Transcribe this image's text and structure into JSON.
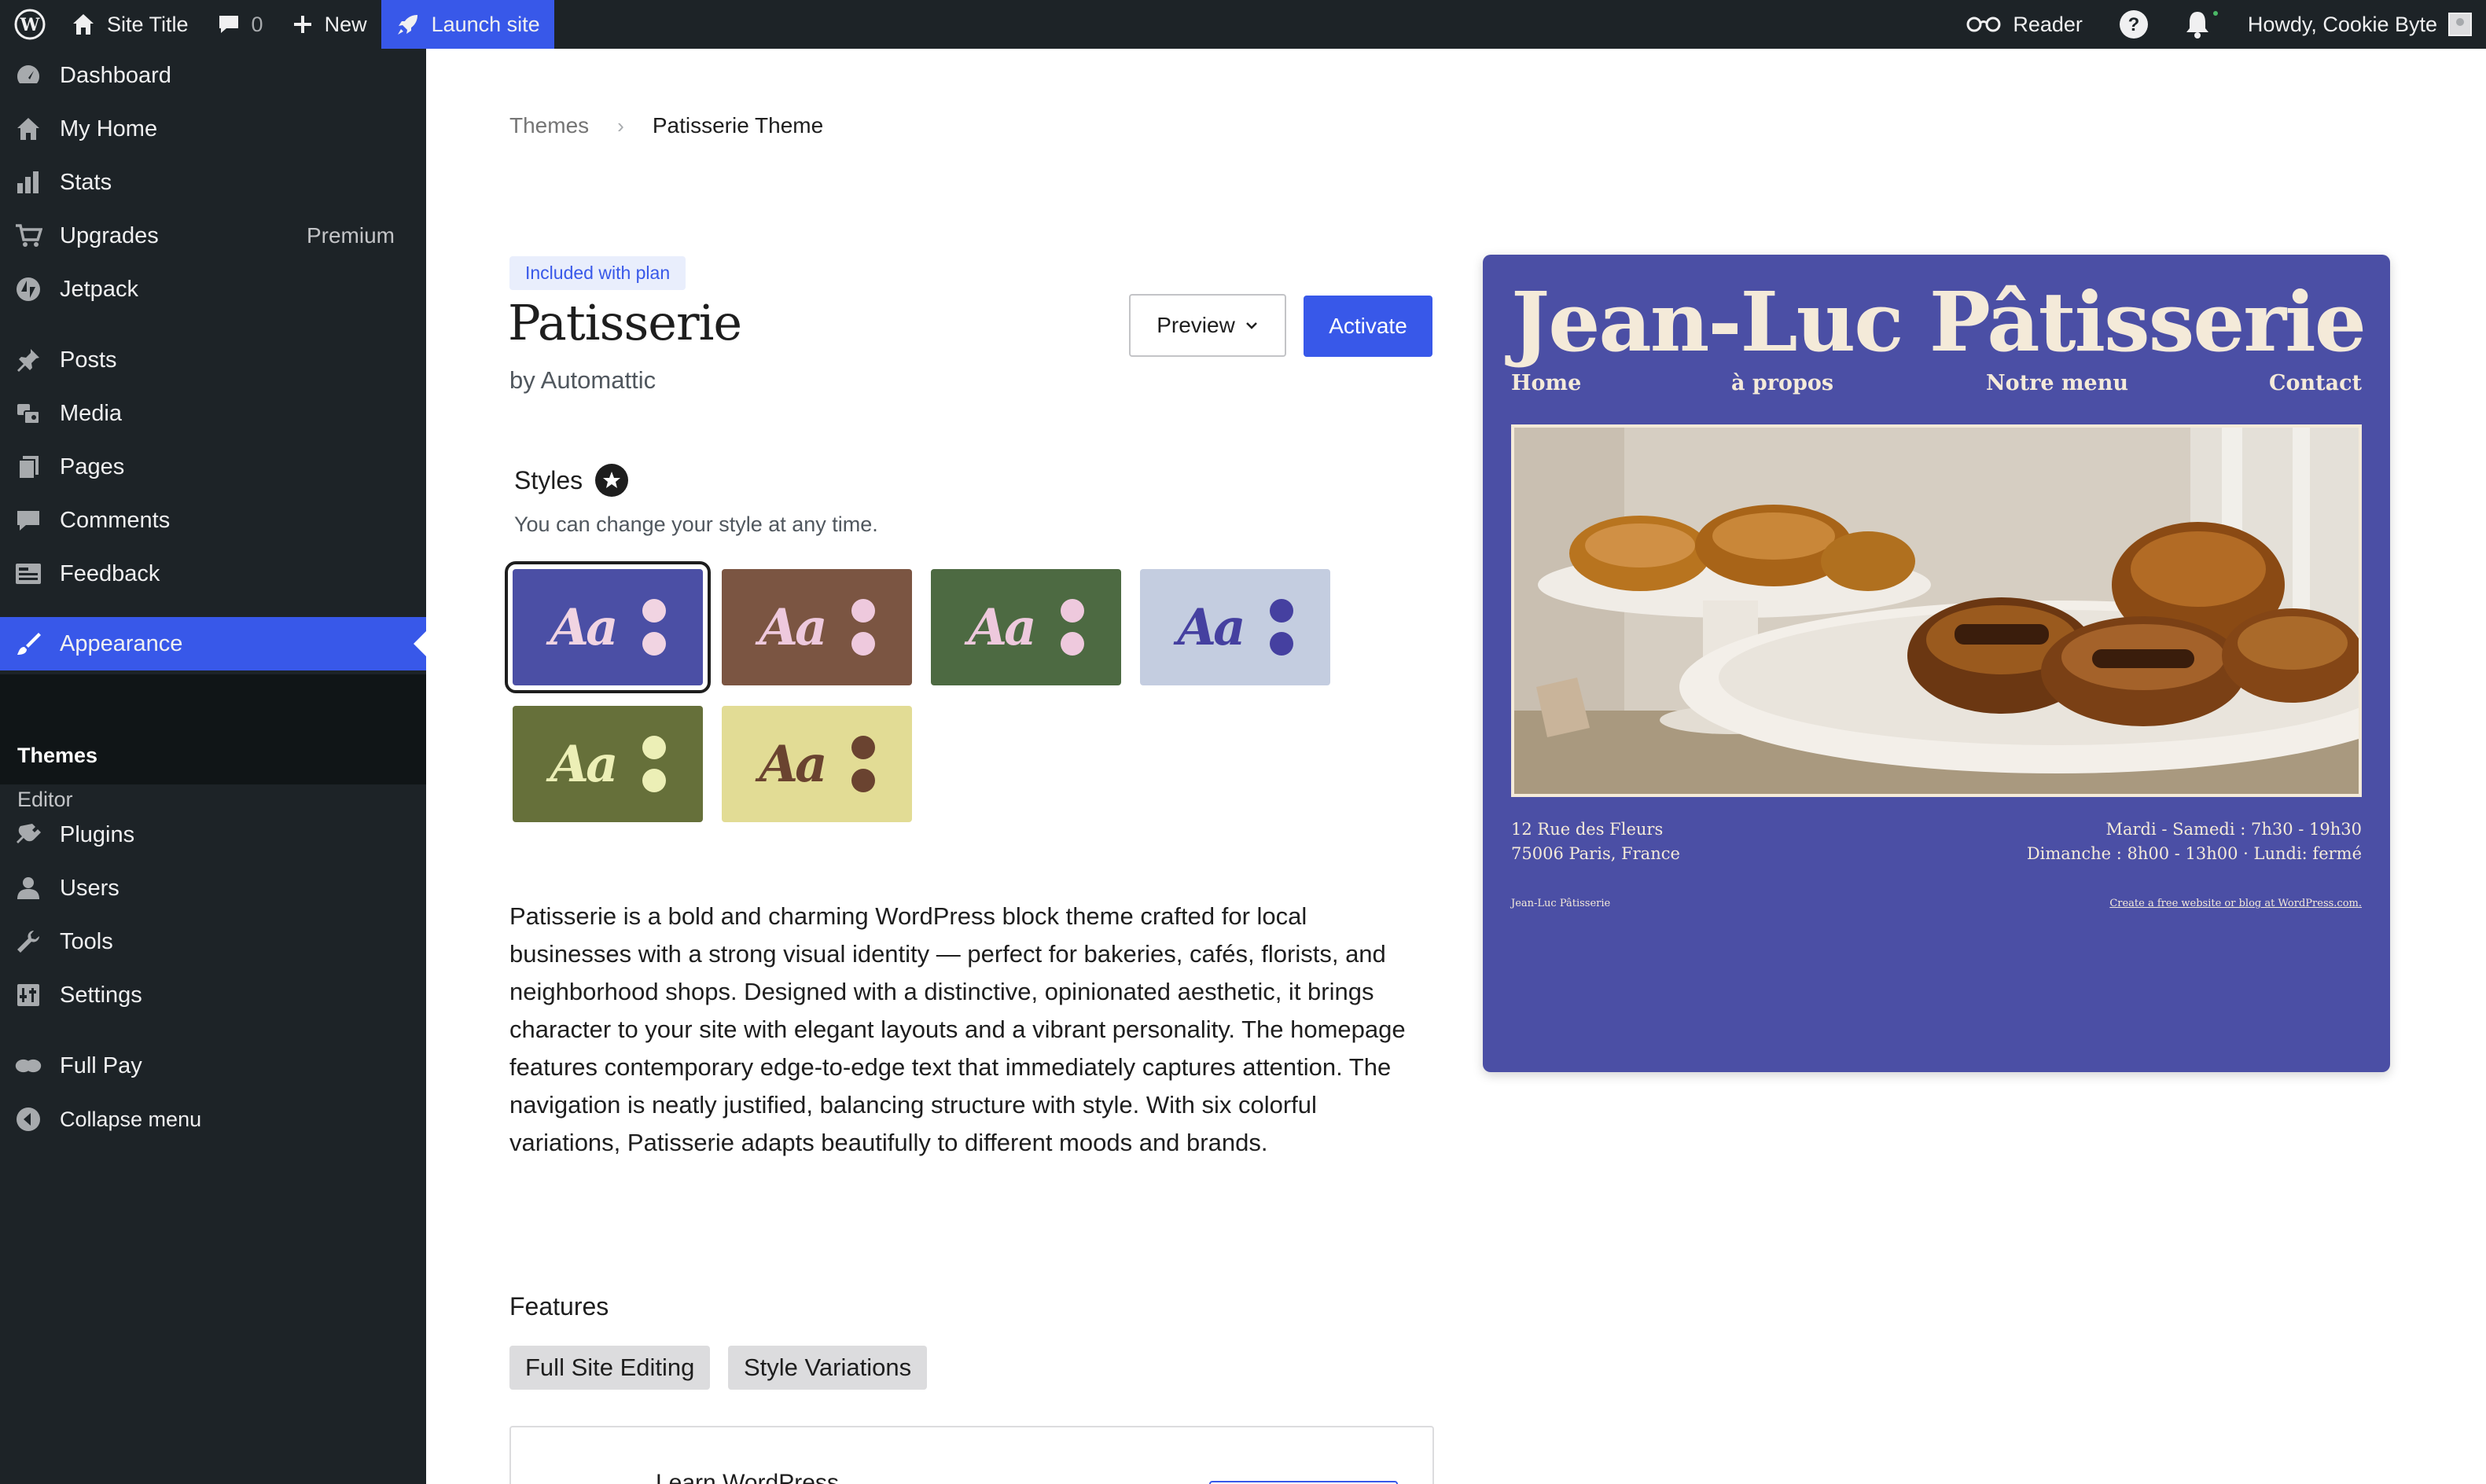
{
  "adminbar": {
    "site_title": "Site Title",
    "comment_count": "0",
    "new_label": "New",
    "launch_label": "Launch site",
    "reader_label": "Reader",
    "howdy_label": "Howdy, Cookie Byte"
  },
  "sidebar": {
    "items": [
      {
        "label": "Dashboard",
        "icon": "dashboard-icon"
      },
      {
        "label": "My Home",
        "icon": "home-icon"
      },
      {
        "label": "Stats",
        "icon": "stats-icon"
      },
      {
        "label": "Upgrades",
        "icon": "cart-icon",
        "badge": "Premium"
      },
      {
        "label": "Jetpack",
        "icon": "jetpack-icon"
      },
      {
        "label": "Posts",
        "icon": "pin-icon"
      },
      {
        "label": "Media",
        "icon": "media-icon"
      },
      {
        "label": "Pages",
        "icon": "pages-icon"
      },
      {
        "label": "Comments",
        "icon": "comment-icon"
      },
      {
        "label": "Feedback",
        "icon": "feedback-icon"
      },
      {
        "label": "Appearance",
        "icon": "brush-icon"
      },
      {
        "label": "Plugins",
        "icon": "plug-icon"
      },
      {
        "label": "Users",
        "icon": "user-icon"
      },
      {
        "label": "Tools",
        "icon": "wrench-icon"
      },
      {
        "label": "Settings",
        "icon": "settings-icon"
      },
      {
        "label": "Full Pay",
        "icon": "fullpay-icon"
      },
      {
        "label": "Collapse menu",
        "icon": "collapse-icon"
      }
    ],
    "submenu": [
      "Themes",
      "Editor"
    ]
  },
  "breadcrumb": {
    "parent": "Themes",
    "current": "Patisserie Theme"
  },
  "theme": {
    "badge": "Included with plan",
    "name": "Patisserie",
    "author": "by Automattic",
    "preview_label": "Preview",
    "activate_label": "Activate"
  },
  "styles": {
    "heading": "Styles",
    "subtext": "You can change your style at any time.",
    "sample": "Aa",
    "variations": [
      {
        "bg": "#4b4fa5",
        "fg": "#f1d4e2",
        "dot1": "#f1d4e2",
        "dot2": "#f1d4e2",
        "selected": true
      },
      {
        "bg": "#7b5542",
        "fg": "#eec9dd",
        "dot1": "#eec9dd",
        "dot2": "#eec9dd",
        "selected": false
      },
      {
        "bg": "#4d6a42",
        "fg": "#eec9dd",
        "dot1": "#eec9dd",
        "dot2": "#eec9dd",
        "selected": false
      },
      {
        "bg": "#c4cde0",
        "fg": "#4540a0",
        "dot1": "#4540a0",
        "dot2": "#4540a0",
        "selected": false
      },
      {
        "bg": "#66703a",
        "fg": "#ecefb6",
        "dot1": "#ecefb6",
        "dot2": "#ecefb6",
        "selected": false
      },
      {
        "bg": "#e2dc95",
        "fg": "#6a4330",
        "dot1": "#6a4330",
        "dot2": "#6a4330",
        "selected": false
      }
    ]
  },
  "description": "Patisserie is a bold and charming WordPress block theme crafted for local businesses with a strong visual identity — perfect for bakeries, cafés, florists, and neighborhood shops. Designed with a distinctive, opinionated aesthetic, it brings character to your site with elegant layouts and a vibrant personality. The homepage features contemporary edge-to-edge text that immediately captures attention. The navigation is neatly justified, balancing structure with style. With six colorful variations, Patisserie adapts beautifully to different moods and brands.",
  "features": {
    "heading": "Features",
    "tags": [
      "Full Site Editing",
      "Style Variations"
    ]
  },
  "learn_card": {
    "title": "Learn WordPress"
  },
  "preview": {
    "title": "Jean-Luc Pâtisserie",
    "nav": [
      "Home",
      "à propos",
      "Notre menu",
      "Contact"
    ],
    "address_line1": "12 Rue des Fleurs",
    "address_line2": "75006 Paris, France",
    "hours_line1": "Mardi - Samedi : 7h30 - 19h30",
    "hours_line2": "Dimanche : 8h00 - 13h00 · Lundi: fermé",
    "footer_left": "Jean-Luc Pâtisserie",
    "footer_right": "Create a free website or blog at WordPress.com.",
    "bg": "#4b4fa5",
    "fg": "#f4ead9"
  },
  "colors": {
    "accent": "#3858e9",
    "admin_bg": "#1d2327"
  }
}
